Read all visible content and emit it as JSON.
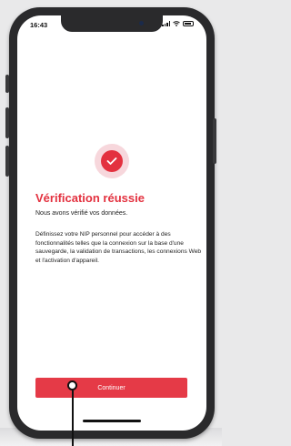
{
  "status_bar": {
    "time": "16:43"
  },
  "content": {
    "icon": "checkmark-icon",
    "title": "Vérification réussie",
    "subtitle": "Nous avons vérifié vos données.",
    "body": "Définissez votre NIP personnel pour accéder à des fonctionnalités telles que la connexion sur la base d'une sauvegarde, la validation de transactions, les connexions Web et l'activation d'appareil."
  },
  "actions": {
    "continue_label": "Continuer"
  },
  "colors": {
    "accent": "#e3313f",
    "accent_soft": "#f7d7dc",
    "phone_frame": "#2a2a2c"
  }
}
